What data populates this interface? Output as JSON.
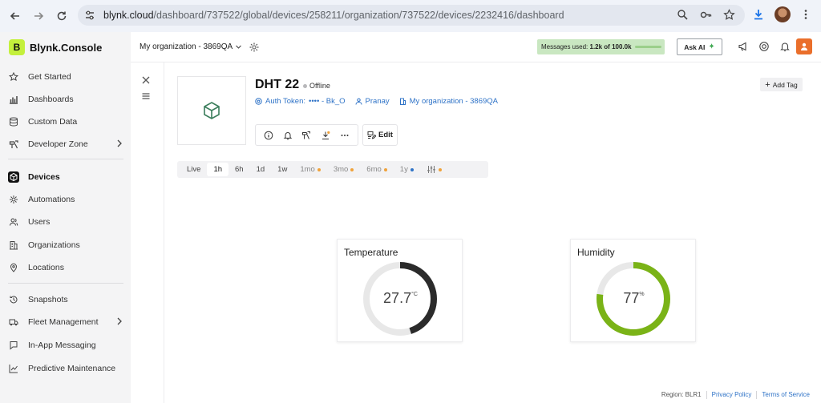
{
  "browser": {
    "url_host": "blynk.cloud",
    "url_path": "/dashboard/737522/global/devices/258211/organization/737522/devices/2232416/dashboard"
  },
  "brand": {
    "logo_letter": "B",
    "name": "Blynk.Console"
  },
  "sidebar": {
    "items": [
      {
        "label": "Get Started",
        "icon": "star-icon"
      },
      {
        "label": "Dashboards",
        "icon": "chart-icon"
      },
      {
        "label": "Custom Data",
        "icon": "database-icon"
      },
      {
        "label": "Developer Zone",
        "icon": "tools-icon"
      },
      {
        "label": "Devices",
        "icon": "cube-icon"
      },
      {
        "label": "Automations",
        "icon": "automation-icon"
      },
      {
        "label": "Users",
        "icon": "users-icon"
      },
      {
        "label": "Organizations",
        "icon": "building-icon"
      },
      {
        "label": "Locations",
        "icon": "pin-icon"
      },
      {
        "label": "Snapshots",
        "icon": "history-icon"
      },
      {
        "label": "Fleet Management",
        "icon": "truck-icon"
      },
      {
        "label": "In-App Messaging",
        "icon": "chat-icon"
      },
      {
        "label": "Predictive Maintenance",
        "icon": "trend-icon"
      }
    ]
  },
  "topbar": {
    "org_select": "My organization - 3869QA",
    "messages_label": "Messages used:",
    "messages_value": "1.2k of 100.0k",
    "messages_fraction": 0.012,
    "ask_ai": "Ask AI"
  },
  "device": {
    "name": "DHT 22",
    "status": "Offline",
    "auth_token_label": "Auth Token:",
    "auth_token_value": "•••• - Bk_O",
    "owner": "Pranay",
    "organization": "My organization - 3869QA",
    "add_tag": "Add Tag",
    "edit": "Edit"
  },
  "time_ranges": [
    {
      "label": "Live",
      "selected": false,
      "dot": ""
    },
    {
      "label": "1h",
      "selected": true,
      "dot": ""
    },
    {
      "label": "6h",
      "selected": false,
      "dot": ""
    },
    {
      "label": "1d",
      "selected": false,
      "dot": ""
    },
    {
      "label": "1w",
      "selected": false,
      "dot": ""
    },
    {
      "label": "1mo",
      "selected": false,
      "dot": "orange"
    },
    {
      "label": "3mo",
      "selected": false,
      "dot": "orange"
    },
    {
      "label": "6mo",
      "selected": false,
      "dot": "orange"
    },
    {
      "label": "1y",
      "selected": false,
      "dot": "blue"
    }
  ],
  "widgets": {
    "temperature": {
      "title": "Temperature",
      "value": "27.7",
      "unit": "°C",
      "fraction": 0.45,
      "color": "#2b2b2b"
    },
    "humidity": {
      "title": "Humidity",
      "value": "77",
      "unit": "%",
      "fraction": 0.77,
      "color": "#7ab317"
    }
  },
  "footer": {
    "region": "Region: BLR1",
    "privacy": "Privacy Policy",
    "terms": "Terms of Service"
  }
}
